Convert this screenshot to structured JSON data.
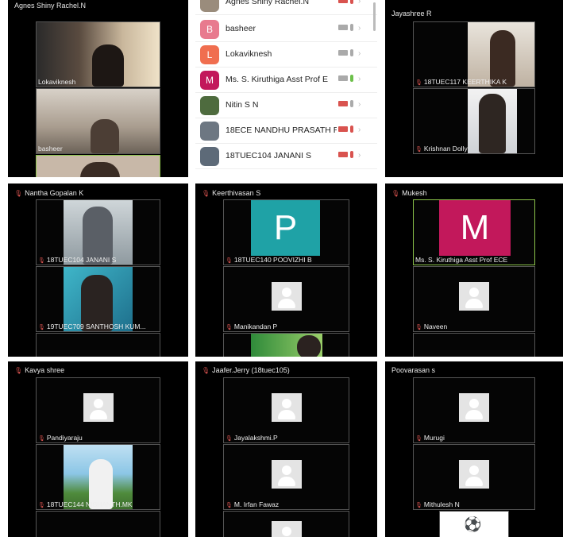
{
  "participants_panel": {
    "items": [
      {
        "name": "Agnes Shiny Rachel.N",
        "avatar": "",
        "avatar_color": "#9a8c7c",
        "cam": "off",
        "mic": "off"
      },
      {
        "name": "basheer",
        "avatar": "B",
        "avatar_color": "#e87a8e",
        "cam": "on",
        "mic": "muted"
      },
      {
        "name": "Lokaviknesh",
        "avatar": "L",
        "avatar_color": "#f06e4f",
        "cam": "on",
        "mic": "muted"
      },
      {
        "name": "Ms. S. Kiruthiga Asst Prof E",
        "avatar": "M",
        "avatar_color": "#c2185b",
        "cam": "on",
        "mic": "on"
      },
      {
        "name": "Nitin S N",
        "avatar": "",
        "avatar_color": "#4e6b3e",
        "cam": "off",
        "mic": "muted"
      },
      {
        "name": "18ECE NANDHU PRASATH R",
        "avatar": "",
        "avatar_color": "#6d7782",
        "cam": "off",
        "mic": "off"
      },
      {
        "name": "18TUEC104 JANANI S",
        "avatar": "",
        "avatar_color": "#5d6a78",
        "cam": "off",
        "mic": "off"
      }
    ]
  },
  "grid": {
    "panel1": {
      "header": "Agnes Shiny Rachel.N",
      "tiles": [
        {
          "label": "Lokaviknesh"
        },
        {
          "label": "basheer"
        }
      ]
    },
    "panel3": {
      "header": "Jayashree R",
      "tiles": [
        {
          "label": "18TUEC117 KEERTHIKA K"
        },
        {
          "label": "Krishnan Dolly"
        }
      ]
    },
    "panel4": {
      "header": "Nantha Gopalan K",
      "tiles": [
        {
          "label": "18TUEC104 JANANI S"
        },
        {
          "label": "19TUEC709 SANTHOSH KUM..."
        }
      ]
    },
    "panel5": {
      "header": "Keerthivasan S",
      "tiles": [
        {
          "label": "18TUEC140 POOVIZHI B",
          "avatar_letter": "P",
          "avatar_color": "#1fa2a6"
        },
        {
          "label": "Manikandan P"
        }
      ]
    },
    "panel6": {
      "header": "Mukesh",
      "tiles": [
        {
          "label": "Ms. S. Kiruthiga Asst Prof ECE",
          "avatar_letter": "M",
          "avatar_color": "#c2185b"
        },
        {
          "label": "Naveen"
        }
      ]
    },
    "panel7": {
      "header": "Kavya shree",
      "tiles": [
        {
          "label": "Pandiyaraju"
        },
        {
          "label": "18TUEC144 NISHANTH.MK"
        }
      ]
    },
    "panel8": {
      "header": "Jaafer.Jerry (18tuec105)",
      "tiles": [
        {
          "label": "Jayalakshmi.P"
        },
        {
          "label": "M. Irfan Fawaz"
        }
      ]
    },
    "panel9": {
      "header": "Poovarasan s",
      "tiles": [
        {
          "label": "Murugi"
        },
        {
          "label": "Mithulesh N"
        }
      ]
    }
  },
  "icons": {
    "mic_muted": "mic-muted-icon",
    "camera": "camera-icon",
    "avatar_placeholder": "person-placeholder-icon",
    "chevron": "chevron-right-icon"
  },
  "colors": {
    "speaking_border": "#8bc34a",
    "muted_red": "#d9534f",
    "unmuted_green": "#6cc04a"
  }
}
